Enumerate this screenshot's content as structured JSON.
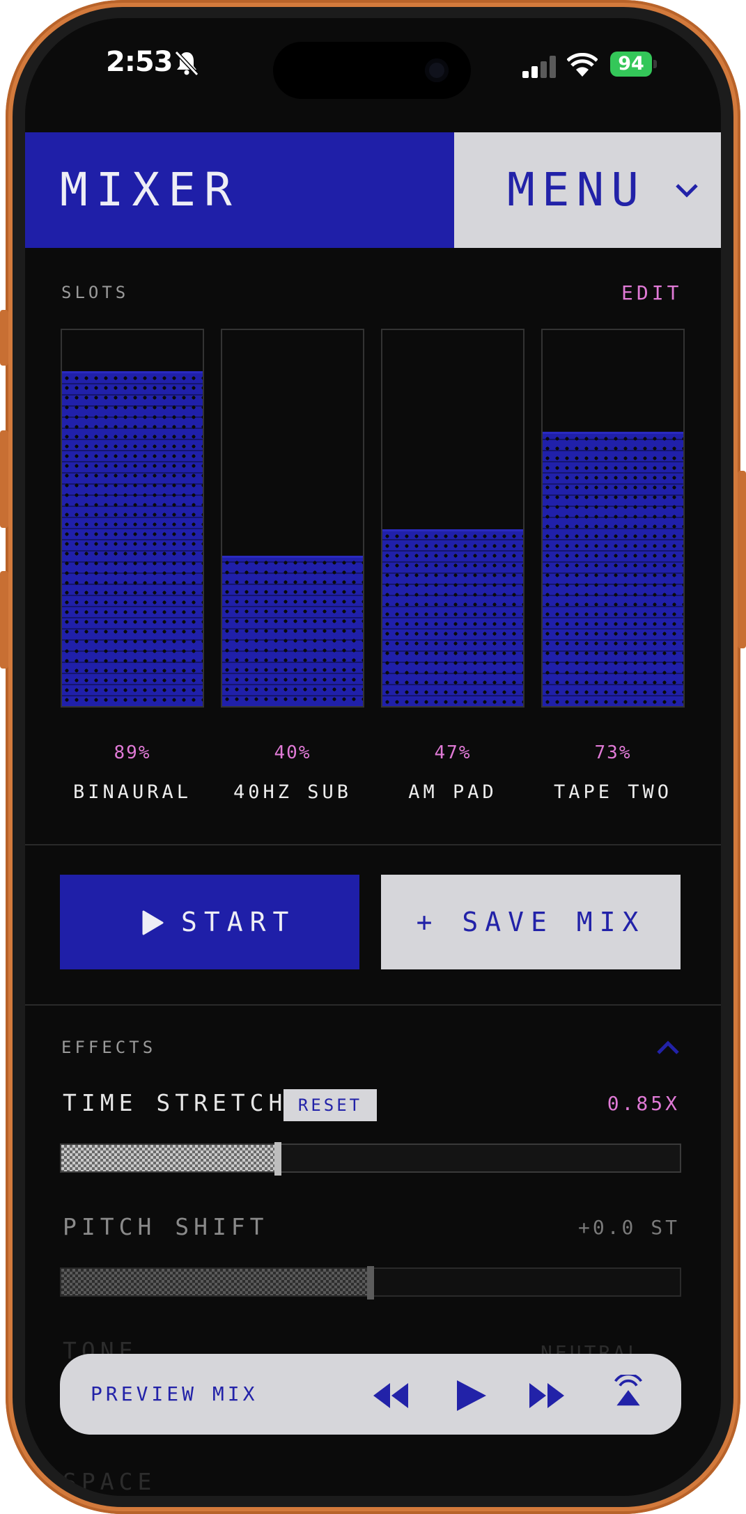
{
  "status": {
    "time": "2:53",
    "battery": "94"
  },
  "header": {
    "title": "MIXER",
    "menu_label": "MENU"
  },
  "slots": {
    "label": "SLOTS",
    "edit_label": "EDIT",
    "items": [
      {
        "name": "BINAURAL",
        "level_pct": 89,
        "level_label": "89%"
      },
      {
        "name": "40HZ SUB",
        "level_pct": 40,
        "level_label": "40%"
      },
      {
        "name": "AM PAD",
        "level_pct": 47,
        "level_label": "47%"
      },
      {
        "name": "TAPE TWO",
        "level_pct": 73,
        "level_label": "73%"
      }
    ]
  },
  "actions": {
    "start_label": "START",
    "save_label": "+ SAVE MIX"
  },
  "effects": {
    "label": "EFFECTS",
    "time_stretch": {
      "name": "TIME STRETCH",
      "reset_label": "RESET",
      "value": "0.85X",
      "level_pct": 35
    },
    "pitch_shift": {
      "name": "PITCH SHIFT",
      "value": "+0.0 ST",
      "level_pct": 50
    },
    "tone": {
      "name": "TONE",
      "value": "NEUTRAL"
    },
    "space": {
      "name": "SPACE"
    }
  },
  "player": {
    "label": "PREVIEW MIX"
  },
  "colors": {
    "accent_blue": "#1f1fa8",
    "pink": "#e07ad6",
    "light_gray": "#d6d6da",
    "background": "#0b0b0b"
  }
}
